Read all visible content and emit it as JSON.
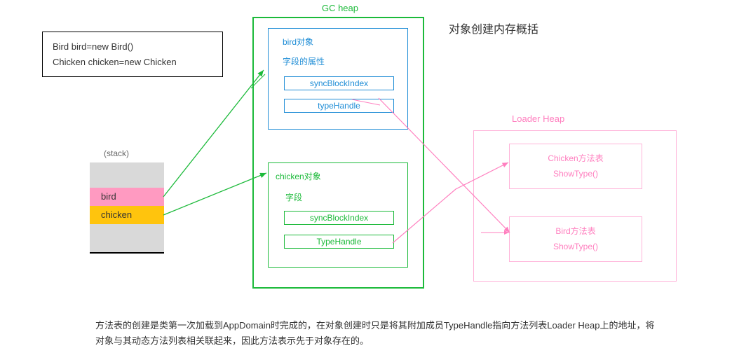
{
  "code_box": {
    "line1": "Bird bird=new Bird()",
    "line2": "Chicken chicken=new Chicken"
  },
  "gc_heap": {
    "title": "GC heap",
    "bird_object": {
      "name": "bird对象",
      "fields_label": "字段的属性",
      "sync": "syncBlockIndex",
      "typehandle": "typeHandle"
    },
    "chicken_object": {
      "name": "chicken对象",
      "fields_label": "字段",
      "sync": "syncBlockIndex",
      "typehandle": "TypeHandle"
    }
  },
  "loader_heap": {
    "title": "Loader Heap",
    "chicken_table": {
      "name": "Chicken方法表",
      "method": "ShowType()"
    },
    "bird_table": {
      "name": "Bird方法表",
      "method": "ShowType()"
    }
  },
  "stack": {
    "label": "(stack)",
    "bird": "bird",
    "chicken": "chicken"
  },
  "title": "对象创建内存概括",
  "footnote": "方法表的创建是类第一次加载到AppDomain时完成的，在对象创建时只是将其附加成员TypeHandle指向方法列表Loader Heap上的地址，将对象与其动态方法列表相关联起来，因此方法表示先于对象存在的。"
}
